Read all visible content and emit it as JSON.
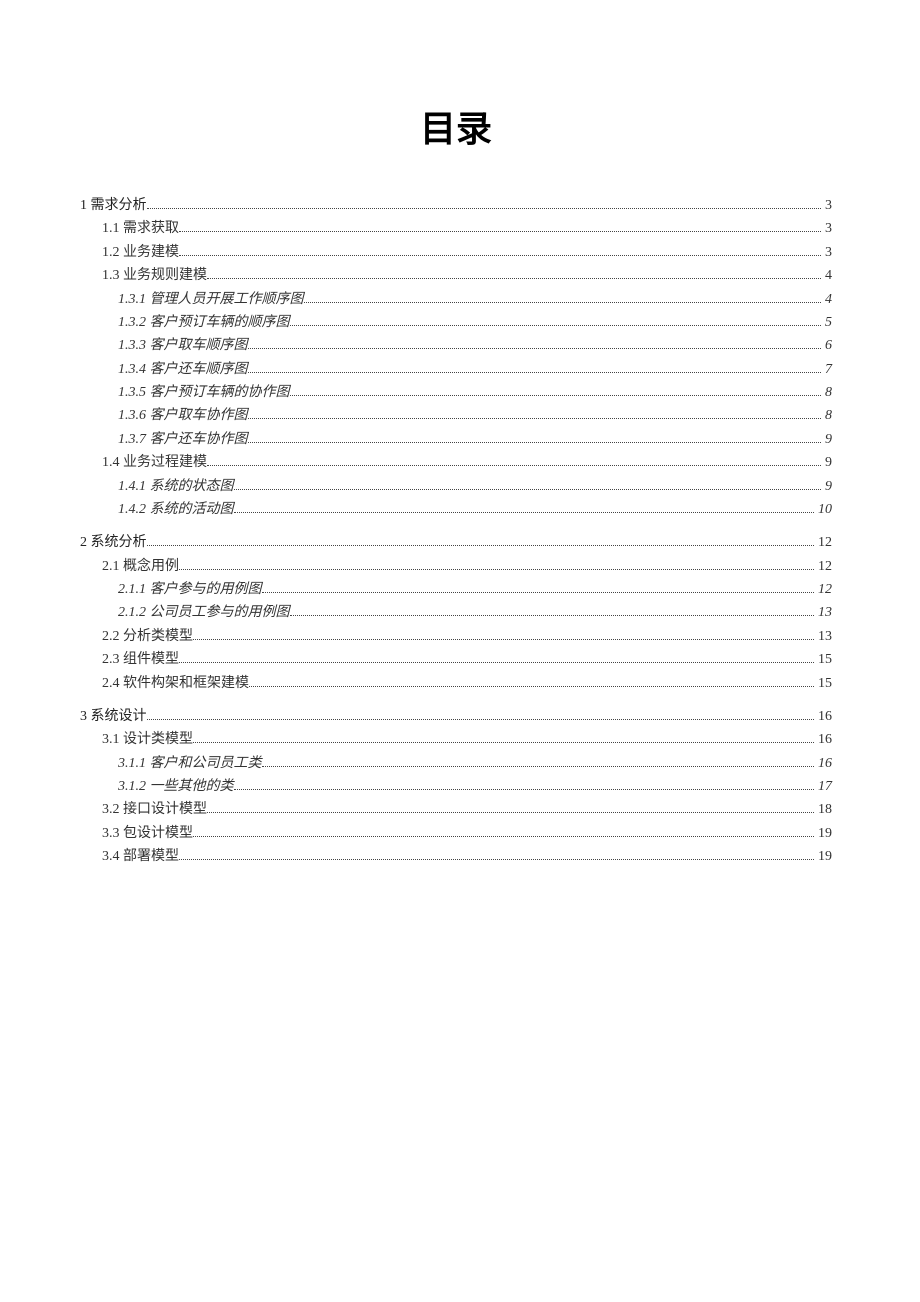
{
  "title": "目录",
  "entries": [
    {
      "level": 1,
      "label": "1 需求分析",
      "page": "3"
    },
    {
      "level": 2,
      "label": "1.1 需求获取",
      "page": "3"
    },
    {
      "level": 2,
      "label": "1.2 业务建模",
      "page": "3"
    },
    {
      "level": 2,
      "label": "1.3 业务规则建模",
      "page": "4"
    },
    {
      "level": 3,
      "label": "1.3.1 管理人员开展工作顺序图",
      "page": "4"
    },
    {
      "level": 3,
      "label": "1.3.2 客户预订车辆的顺序图",
      "page": "5"
    },
    {
      "level": 3,
      "label": "1.3.3 客户取车顺序图",
      "page": "6"
    },
    {
      "level": 3,
      "label": "1.3.4 客户还车顺序图",
      "page": "7"
    },
    {
      "level": 3,
      "label": "1.3.5  客户预订车辆的协作图",
      "page": "8"
    },
    {
      "level": 3,
      "label": "1.3.6 客户取车协作图",
      "page": "8"
    },
    {
      "level": 3,
      "label": "1.3.7 客户还车协作图",
      "page": "9"
    },
    {
      "level": 2,
      "label": "1.4 业务过程建模",
      "page": "9"
    },
    {
      "level": 3,
      "label": "1.4.1 系统的状态图",
      "page": "9"
    },
    {
      "level": 3,
      "label": "1.4.2 系统的活动图",
      "page": "10"
    },
    {
      "level": 1,
      "label": "2 系统分析",
      "page": "12"
    },
    {
      "level": 2,
      "label": "2.1 概念用例",
      "page": "12"
    },
    {
      "level": 3,
      "label": "2.1.1 客户参与的用例图",
      "page": "12"
    },
    {
      "level": 3,
      "label": "2.1.2 公司员工参与的用例图",
      "page": "13"
    },
    {
      "level": 2,
      "label": "2.2 分析类模型",
      "page": "13"
    },
    {
      "level": 2,
      "label": "2.3 组件模型",
      "page": "15"
    },
    {
      "level": 2,
      "label": "2.4 软件构架和框架建模",
      "page": "15"
    },
    {
      "level": 1,
      "label": "3 系统设计",
      "page": "16"
    },
    {
      "level": 2,
      "label": "3.1 设计类模型",
      "page": "16"
    },
    {
      "level": 3,
      "label": "3.1.1 客户和公司员工类",
      "page": "16"
    },
    {
      "level": 3,
      "label": "3.1.2 一些其他的类",
      "page": "17"
    },
    {
      "level": 2,
      "label": "3.2 接口设计模型",
      "page": "18"
    },
    {
      "level": 2,
      "label": "3.3 包设计模型",
      "page": "19"
    },
    {
      "level": 2,
      "label": "3.4 部署模型",
      "page": "19"
    }
  ]
}
